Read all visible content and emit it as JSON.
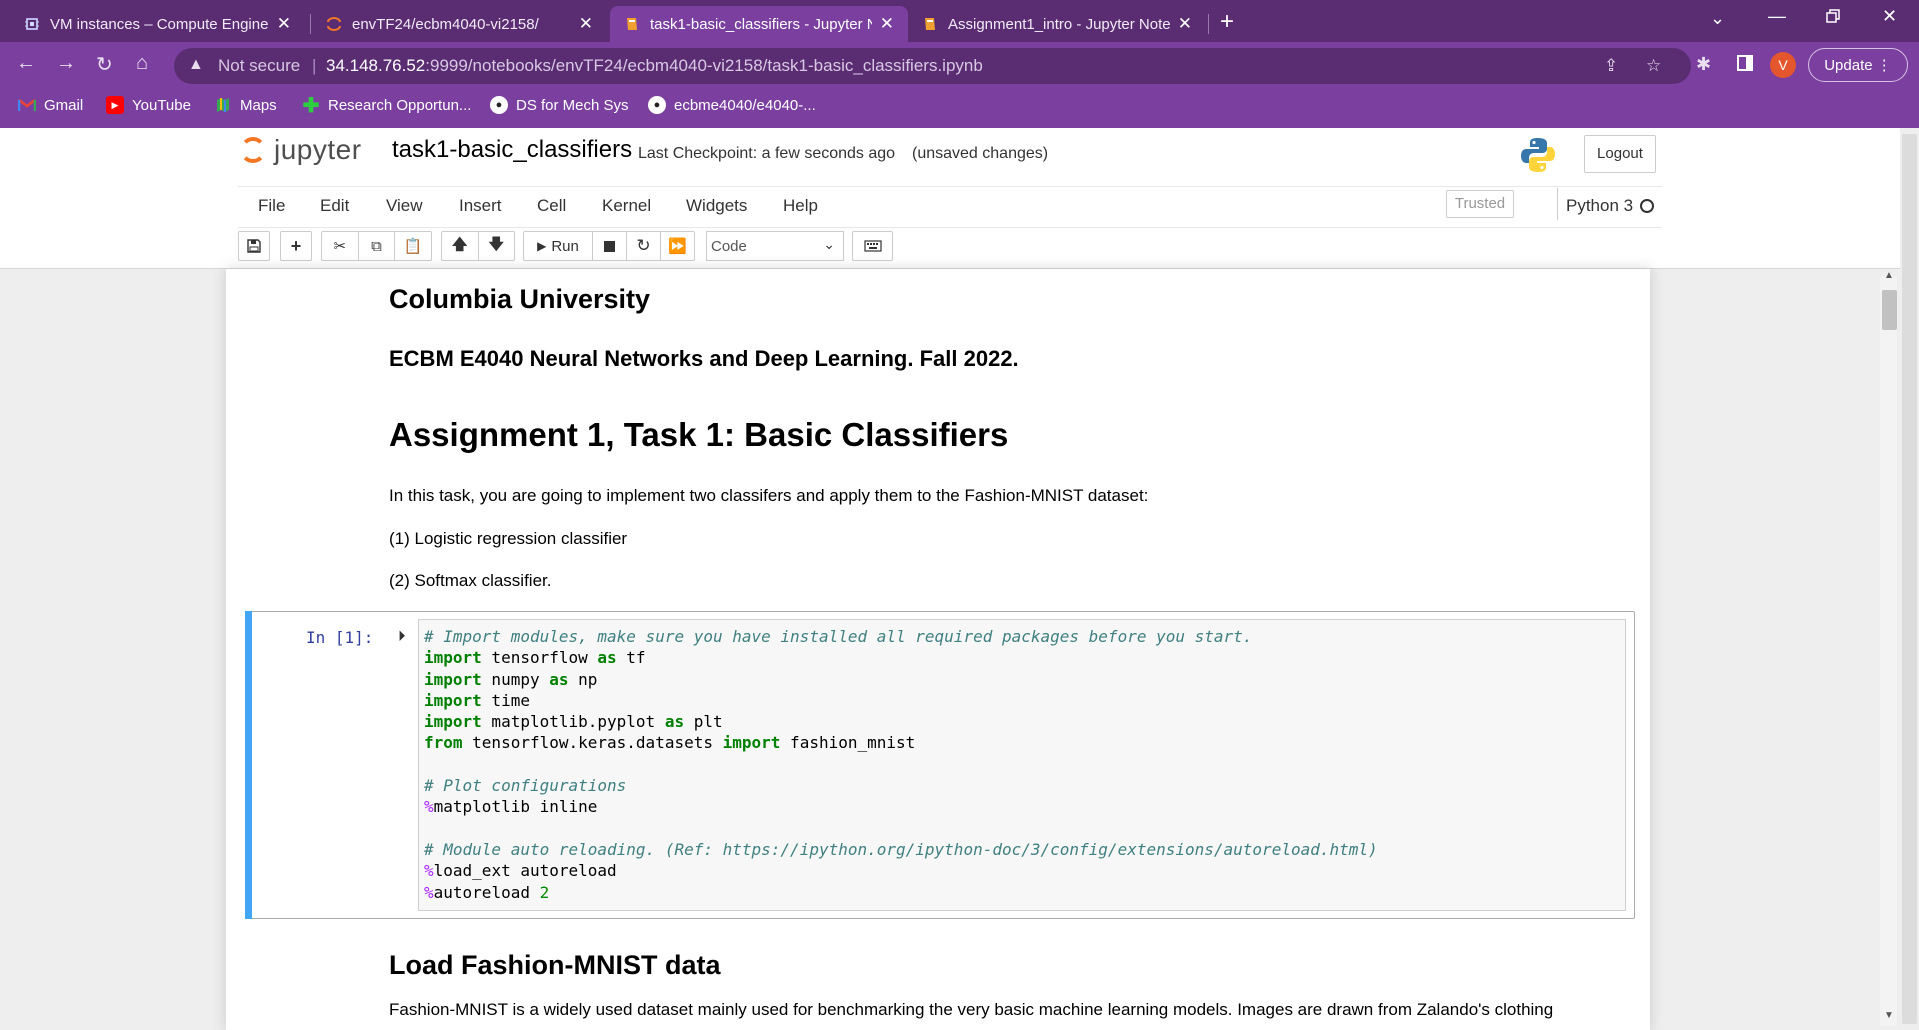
{
  "browser": {
    "tabs": [
      {
        "title": "VM instances – Compute Engine",
        "icon": "compute-engine-icon"
      },
      {
        "title": "envTF24/ecbm4040-vi2158/",
        "icon": "jupyter-icon"
      },
      {
        "title": "task1-basic_classifiers - Jupyter N",
        "icon": "jupyter-notebook-icon",
        "active": true
      },
      {
        "title": "Assignment1_intro - Jupyter Note",
        "icon": "jupyter-notebook-icon"
      }
    ],
    "not_secure": "Not secure",
    "url_host": "34.148.76.52",
    "url_rest": ":9999/notebooks/envTF24/ecbm4040-vi2158/task1-basic_classifiers.ipynb",
    "avatar_letter": "V",
    "update_label": "Update",
    "bookmarks": [
      {
        "label": "Gmail",
        "icon": "gmail-icon"
      },
      {
        "label": "YouTube",
        "icon": "youtube-icon"
      },
      {
        "label": "Maps",
        "icon": "maps-icon"
      },
      {
        "label": "Research Opportun...",
        "icon": "plus-icon"
      },
      {
        "label": "DS for Mech Sys",
        "icon": "github-icon"
      },
      {
        "label": "ecbme4040/e4040-...",
        "icon": "github-icon"
      }
    ]
  },
  "jupyter": {
    "logo_text": "jupyter",
    "notebook_name": "task1-basic_classifiers",
    "checkpoint": "Last Checkpoint: a few seconds ago",
    "unsaved": "(unsaved changes)",
    "logout_label": "Logout",
    "menus": [
      "File",
      "Edit",
      "View",
      "Insert",
      "Cell",
      "Kernel",
      "Widgets",
      "Help"
    ],
    "trusted_label": "Trusted",
    "kernel_name": "Python 3",
    "run_label": "Run",
    "cell_type": "Code"
  },
  "notebook": {
    "university": "Columbia University",
    "course": "ECBM E4040 Neural Networks and Deep Learning. Fall 2022.",
    "assignment_title": "Assignment 1, Task 1: Basic Classifiers",
    "intro": "In this task, you are going to implement two classifers and apply them to the Fashion-MNIST dataset:",
    "item1": "(1) Logistic regression classifier",
    "item2": "(2) Softmax classifier.",
    "cell_prompt": "In [1]:",
    "load_heading": "Load Fashion-MNIST data",
    "load_text": "Fashion-MNIST is a widely used dataset mainly used for benchmarking the very basic machine learning models. Images are drawn from Zalando's clothing"
  },
  "colors": {
    "browser_dark": "#5a2d73",
    "browser_accent": "#7b3fa0",
    "cell_selected": "#42a5f5",
    "jupyter_orange": "#f37726"
  }
}
